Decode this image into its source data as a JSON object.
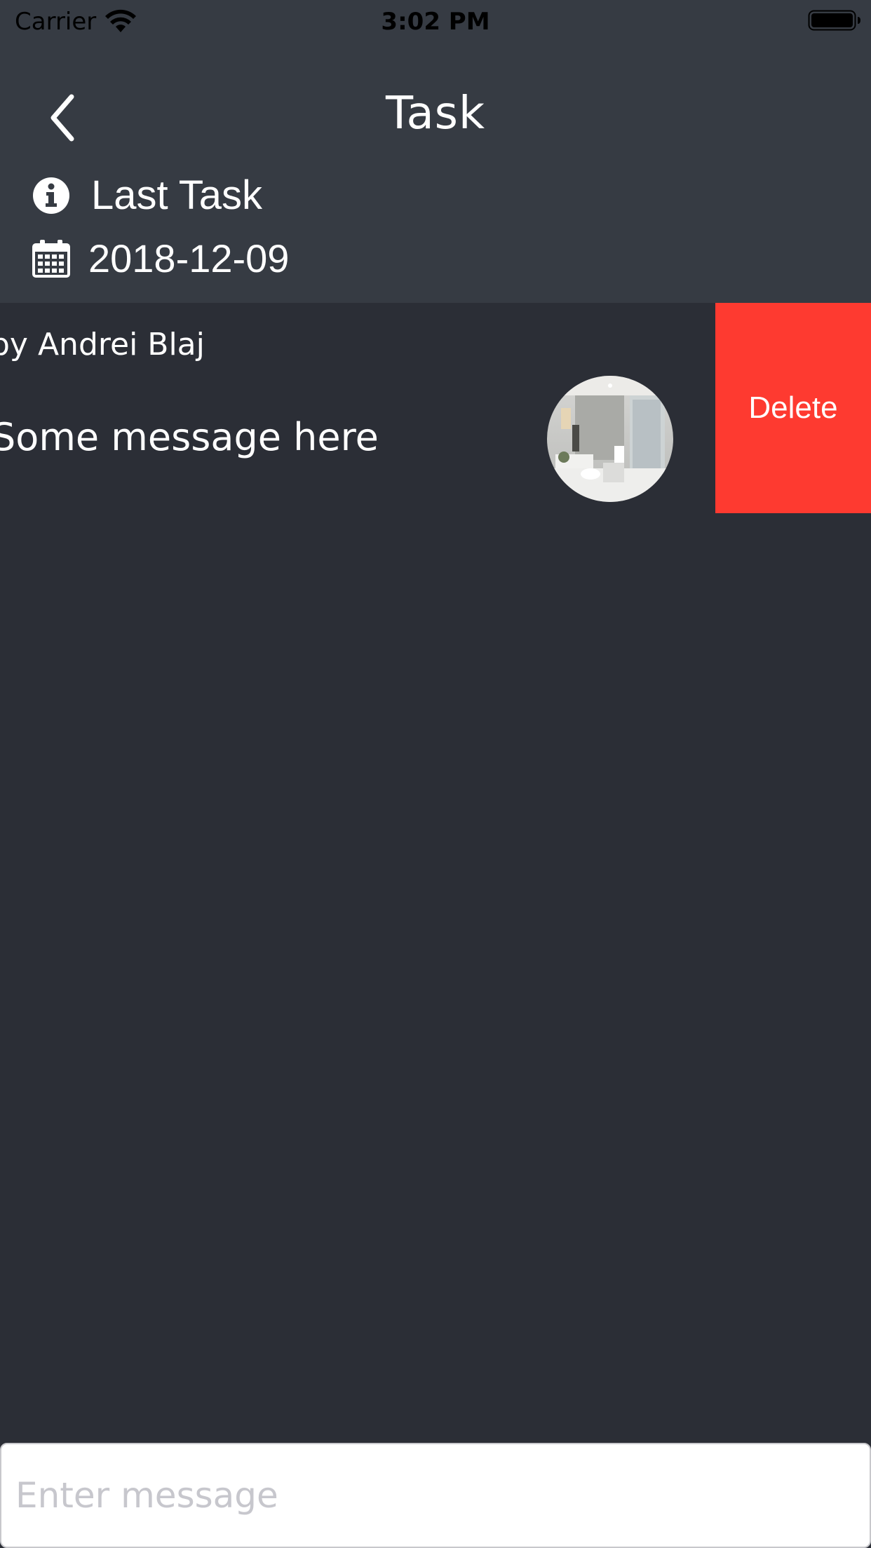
{
  "status_bar": {
    "carrier": "Carrier",
    "time": "3:02 PM",
    "wifi_icon": "wifi-icon",
    "battery_icon": "battery-full-icon"
  },
  "nav": {
    "title": "Task",
    "back_icon": "chevron-left-icon"
  },
  "task": {
    "name": "Last Task",
    "name_icon": "info-icon",
    "date": "2018-12-09",
    "date_icon": "calendar-icon"
  },
  "message": {
    "author": "by Andrei Blaj",
    "text": "Some message here",
    "thumbnail": "bathroom-photo",
    "delete_label": "Delete"
  },
  "composer": {
    "placeholder": "Enter message",
    "value": ""
  },
  "colors": {
    "header_bg": "#363b43",
    "content_bg": "#2b2e36",
    "delete_bg": "#fe3a30",
    "text": "#ffffff",
    "placeholder": "#c7c7cd"
  }
}
